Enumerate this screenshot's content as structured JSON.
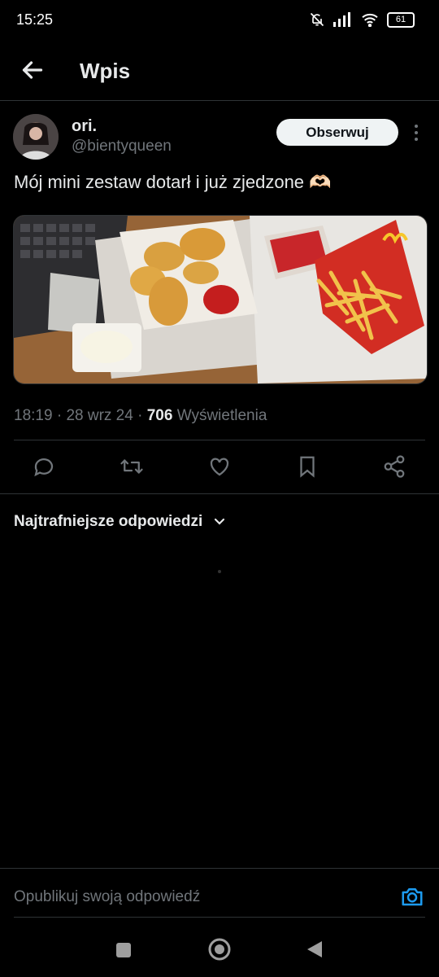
{
  "status_bar": {
    "time": "15:25",
    "battery": "61",
    "icons": [
      "bell-muted-icon",
      "signal-icon",
      "wifi-icon",
      "battery-icon"
    ]
  },
  "header": {
    "title": "Wpis",
    "back_icon": "arrow-left-icon"
  },
  "post": {
    "author_name": "ori.",
    "author_handle": "@bientyqueen",
    "follow_label": "Obserwuj",
    "text": "Mój mini zestaw dotarł i już zjedzone 🫶🏻",
    "image_icon": "food-photo",
    "time": "18:19",
    "date": "28 wrz 24",
    "views_count": "706",
    "views_label": "Wyświetlenia",
    "separator": "·"
  },
  "actions": [
    "reply-icon",
    "retweet-icon",
    "like-icon",
    "bookmark-icon",
    "share-icon"
  ],
  "replies": {
    "sort_label": "Najtrafniejsze odpowiedzi"
  },
  "reply_bar": {
    "placeholder": "Opublikuj swoją odpowiedź"
  },
  "colors": {
    "background": "#000000",
    "text": "#e7e9ea",
    "muted": "#71767b",
    "accent": "#1d9bf0",
    "divider": "#2f3336"
  }
}
